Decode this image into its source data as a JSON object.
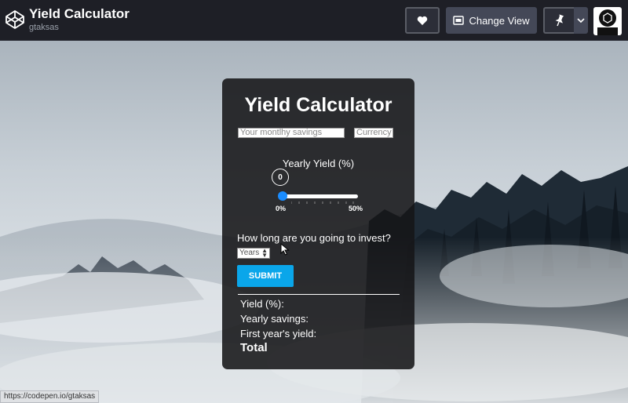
{
  "header": {
    "title": "Yield Calculator",
    "author": "gtaksas",
    "change_view_label": "Change View"
  },
  "card": {
    "title": "Yield Calculator",
    "savings_placeholder": "Your montlhy savings",
    "currency_placeholder": "Currency",
    "yield_label": "Yearly Yield (%)",
    "slider": {
      "value": "0",
      "min_label": "0%",
      "max_label": "50%",
      "min": 0,
      "max": 50,
      "current": 0
    },
    "question": "How long are you going to invest?",
    "period_select": "Years",
    "submit_label": "SUBMIT",
    "results": {
      "yield": "Yield (%):",
      "yearly_savings": "Yearly savings:",
      "first_year_yield": "First year's yield:",
      "total": "Total"
    }
  },
  "status_bar": {
    "url": "https://codepen.io/gtaksas"
  },
  "colors": {
    "submit": "#0aa6ea",
    "slider_thumb": "#1a8cff",
    "topbar": "#1e1f26"
  },
  "icons": [
    "codepen-logo-icon",
    "heart-icon",
    "layout-icon",
    "pin-icon",
    "chevron-down-icon",
    "avatar-icon"
  ]
}
